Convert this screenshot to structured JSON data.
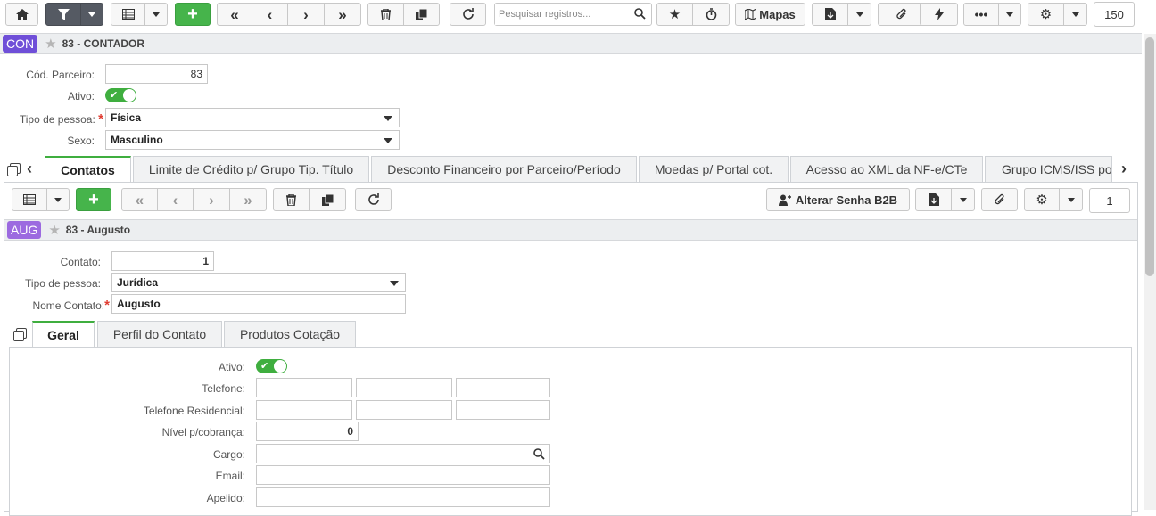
{
  "toolbar": {
    "search_placeholder": "Pesquisar registros...",
    "maps_label": "Mapas",
    "page_size": "150"
  },
  "record": {
    "badge": "CON",
    "title": "83 - CONTADOR",
    "fields": {
      "cod_parceiro_label": "Cód. Parceiro:",
      "cod_parceiro_value": "83",
      "ativo_label": "Ativo:",
      "tipo_pessoa_label": "Tipo de pessoa:",
      "tipo_pessoa_value": "Física",
      "sexo_label": "Sexo:",
      "sexo_value": "Masculino"
    }
  },
  "tabs": [
    {
      "label": "Contatos"
    },
    {
      "label": "Limite de Crédito p/ Grupo Tip. Título"
    },
    {
      "label": "Desconto Financeiro por Parceiro/Período"
    },
    {
      "label": "Moedas p/ Portal cot."
    },
    {
      "label": "Acesso ao XML da NF-e/CTe"
    },
    {
      "label": "Grupo ICMS/ISS po"
    }
  ],
  "subtoolbar": {
    "alterar_senha_label": "Alterar Senha B2B",
    "page_number": "1"
  },
  "contact": {
    "badge": "AUG",
    "title": "83 - Augusto",
    "fields": {
      "contato_label": "Contato:",
      "contato_value": "1",
      "tipo_pessoa_label": "Tipo de pessoa:",
      "tipo_pessoa_value": "Jurídica",
      "nome_label": "Nome Contato:",
      "nome_value": "Augusto"
    }
  },
  "contact_tabs": [
    {
      "label": "Geral"
    },
    {
      "label": "Perfil do Contato"
    },
    {
      "label": "Produtos Cotação"
    }
  ],
  "geral": {
    "ativo_label": "Ativo:",
    "telefone_label": "Telefone:",
    "telefone_res_label": "Telefone Residencial:",
    "nivel_label": "Nível p/cobrança:",
    "nivel_value": "0",
    "cargo_label": "Cargo:",
    "email_label": "Email:",
    "apelido_label": "Apelido:"
  }
}
